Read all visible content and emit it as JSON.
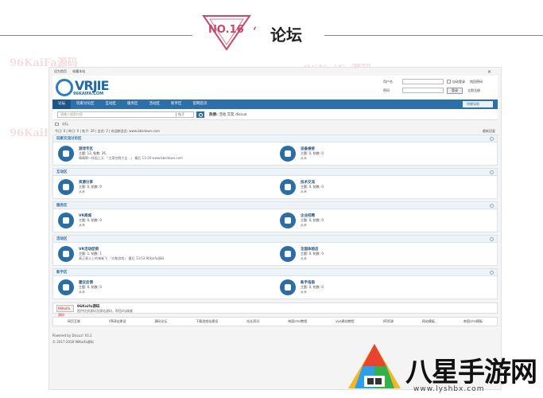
{
  "header": {
    "badge_text": "NO.16",
    "quote": "‘",
    "title": "论坛"
  },
  "watermark": {
    "text": "96KaiFa源码"
  },
  "site": {
    "top_links": [
      "设为首页",
      "收藏本站"
    ],
    "close_glyph": "×",
    "logo_big": "VRJIE",
    "logo_small": "96KAIFA.COM",
    "login": {
      "username_label": "用户名",
      "password_label": "密码",
      "auto_login": "自动登录",
      "forgot": "找回密码",
      "login_btn": "登录",
      "register": "立即注册"
    },
    "nav": [
      "论坛",
      "玩家讨论区",
      "互动区",
      "服务区",
      "活动区",
      "新手区",
      "官网首页"
    ],
    "quick_nav": "快捷导航",
    "search_placeholder": "请输入搜索内容",
    "search_scope": "帖子",
    "hot_label": "热搜:",
    "hot_terms": "活动 交友 discuz",
    "crumb": "论坛",
    "stats": "今日: 0 | 昨日: 0 | 帖子: 26 | 会员: 2 | 欢迎新会员: www.bbsdown.com",
    "newest_reply": "最新回复",
    "categories": [
      {
        "title": "玩家交流讨论区",
        "forums": [
          {
            "name": "游戏专区",
            "stat": "主题: 13, 帖数: 26",
            "last": "晴晴啊一样起上天 『主演空暇大全...』 最后 13:26 www.bbsdown.com",
            "icon": "gamepad-icon"
          },
          {
            "name": "设备维修",
            "stat": "主题: 0, 帖数: 0",
            "last": "从未",
            "icon": "wrench-icon"
          }
        ]
      },
      {
        "title": "互动区",
        "forums": [
          {
            "name": "资源分享",
            "stat": "主题: 0, 帖数: 0",
            "last": "从未",
            "icon": "folder-icon"
          },
          {
            "name": "技术交流",
            "stat": "主题: 0, 帖数: 0",
            "last": "从未",
            "icon": "monitor-icon"
          }
        ]
      },
      {
        "title": "服务区",
        "forums": [
          {
            "name": "VR商城",
            "stat": "主题: 0, 帖数: 0",
            "last": "从未",
            "icon": "cart-icon"
          },
          {
            "name": "企业招聘",
            "stat": "主题: 0, 帖数: 0",
            "last": "从未",
            "icon": "user-icon"
          }
        ]
      },
      {
        "title": "活动区",
        "forums": [
          {
            "name": "VR活动促销",
            "stat": "主题: 1, 帖数: 1",
            "last": "真正意义上的骑者飞 『大聚游戏』 最后 13:53 96kaifa源码",
            "icon": "shield-icon"
          },
          {
            "name": "全国体验店",
            "stat": "主题: 0, 帖数: 0",
            "last": "从未",
            "icon": "compass-icon"
          }
        ]
      },
      {
        "title": "新手区",
        "forums": [
          {
            "name": "建议反馈",
            "stat": "主题: 0, 帖数: 0",
            "last": "从未",
            "icon": "news-icon"
          },
          {
            "name": "新手指南",
            "stat": "主题: 0, 帖数: 0",
            "last": "从未",
            "icon": "person-icon"
          }
        ]
      }
    ],
    "link_logo": "96Kaifa源码",
    "link_title": "96Kaifa源码",
    "link_desc": "提供优质源码及建站源码，帮您diy精美",
    "friends": [
      "网页互联",
      "VR网站建设",
      "源码论坛",
      "下载游戏站建设",
      "站长资讯",
      "帝国cms教程",
      "vue建站教程",
      "VR资源",
      "网站模板",
      "帝国cms模板"
    ],
    "powered": "Powered by Discuz! X3.2",
    "copyright": "© 2017-2018 96KaiFa源码"
  },
  "app": {
    "name": "八星手游网",
    "url": "www.lyshbx.com"
  }
}
